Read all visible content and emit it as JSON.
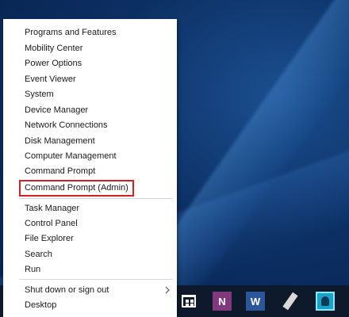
{
  "menu": {
    "items": [
      {
        "label": "Programs and Features"
      },
      {
        "label": "Mobility Center"
      },
      {
        "label": "Power Options"
      },
      {
        "label": "Event Viewer"
      },
      {
        "label": "System"
      },
      {
        "label": "Device Manager"
      },
      {
        "label": "Network Connections"
      },
      {
        "label": "Disk Management"
      },
      {
        "label": "Computer Management"
      },
      {
        "label": "Command Prompt"
      },
      {
        "label": "Command Prompt (Admin)"
      },
      {
        "label": "Task Manager"
      },
      {
        "label": "Control Panel"
      },
      {
        "label": "File Explorer"
      },
      {
        "label": "Search"
      },
      {
        "label": "Run"
      },
      {
        "label": "Shut down or sign out"
      },
      {
        "label": "Desktop"
      }
    ],
    "highlight_color": "#d32027"
  },
  "taskbar": {
    "icons": [
      "store-icon",
      "onenote-icon",
      "word-icon",
      "pen-icon",
      "photo-icon"
    ],
    "onenote_letter": "N",
    "word_letter": "W",
    "background": "#0e1a2b"
  }
}
